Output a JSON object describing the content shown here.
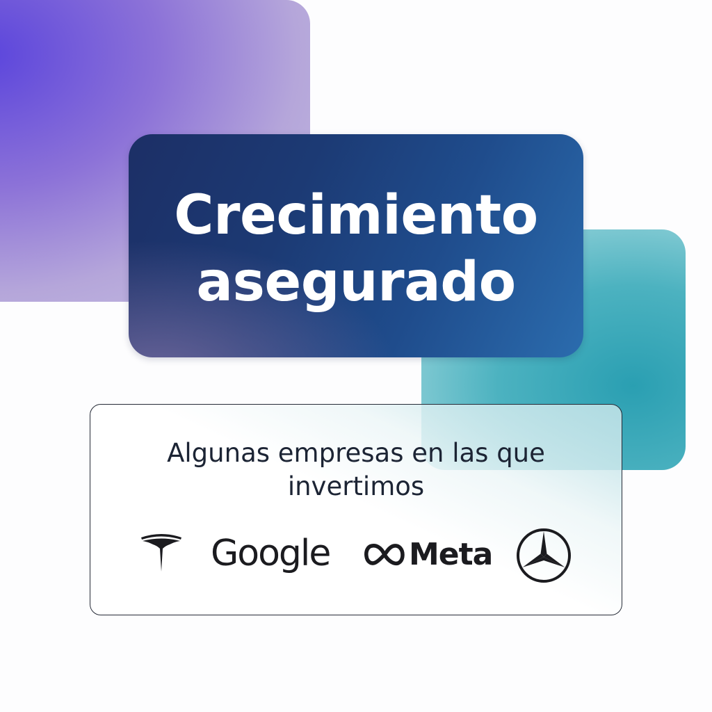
{
  "hero": {
    "title_line1": "Crecimiento",
    "title_line2": "asegurado"
  },
  "companies": {
    "heading_line1": "Algunas empresas en las que",
    "heading_line2": "invertimos",
    "logos": [
      {
        "name": "Tesla",
        "icon": "tesla-logo-icon"
      },
      {
        "name": "Google",
        "text": "Google"
      },
      {
        "name": "Meta",
        "icon": "meta-infinity-icon",
        "text": "Meta"
      },
      {
        "name": "Mercedes-Benz",
        "icon": "mercedes-star-icon"
      }
    ]
  },
  "colors": {
    "purple_accent": "#5b45dc",
    "navy_card": "#1c3a74",
    "blue_card": "#2b6cae",
    "teal_accent": "#2a9fb2",
    "text_dark": "#1c2434"
  }
}
